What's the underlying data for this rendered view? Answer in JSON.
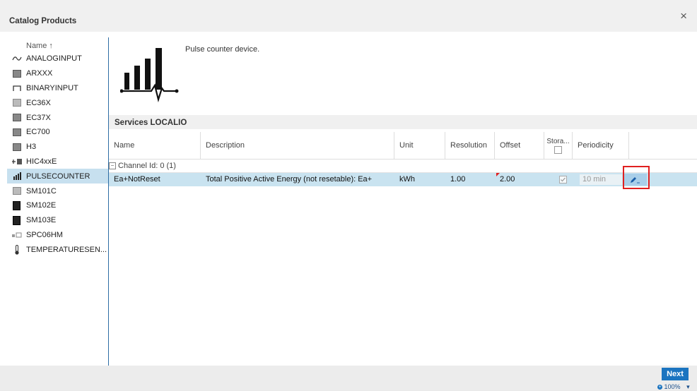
{
  "dialog": {
    "title": "Catalog Products",
    "close_glyph": "×"
  },
  "left_panel": {
    "header": "Name ↑",
    "items": [
      {
        "label": "ANALOGINPUT",
        "icon": "analog-wave-icon"
      },
      {
        "label": "ARXXX",
        "icon": "device-icon"
      },
      {
        "label": "BINARYINPUT",
        "icon": "square-pulse-icon"
      },
      {
        "label": "EC36X",
        "icon": "device-icon"
      },
      {
        "label": "EC37X",
        "icon": "device-icon"
      },
      {
        "label": "EC700",
        "icon": "device-icon"
      },
      {
        "label": "H3",
        "icon": "device-icon"
      },
      {
        "label": "HIC4xxE",
        "icon": "connector-icon"
      },
      {
        "label": "PULSECOUNTER",
        "icon": "bars-icon",
        "selected": true
      },
      {
        "label": "SM101C",
        "icon": "device-icon"
      },
      {
        "label": "SM102E",
        "icon": "device-dark-icon"
      },
      {
        "label": "SM103E",
        "icon": "device-dark-icon"
      },
      {
        "label": "SPC06HM",
        "icon": "device-icon"
      },
      {
        "label": "TEMPERATURESEN...",
        "icon": "thermometer-icon"
      }
    ]
  },
  "product": {
    "description": "Pulse counter device."
  },
  "services": {
    "title": "Services LOCALIO",
    "columns": [
      "Name",
      "Description",
      "Unit",
      "Resolution",
      "Offset",
      "Stora...",
      "Periodicity"
    ],
    "group_label": "Channel Id: 0 (1)",
    "rows": [
      {
        "name": "Ea+NotReset",
        "description": "Total Positive Active Energy (not resetable): Ea+",
        "unit": "kWh",
        "resolution": "1.00",
        "offset": "2.00",
        "storage": true,
        "periodicity": "10 min"
      }
    ]
  },
  "footer": {
    "next_label": "Next",
    "zoom": "100%"
  },
  "colors": {
    "accent": "#1b74c0",
    "selected_row": "#c9e3f0",
    "highlight_box": "#e02020"
  }
}
